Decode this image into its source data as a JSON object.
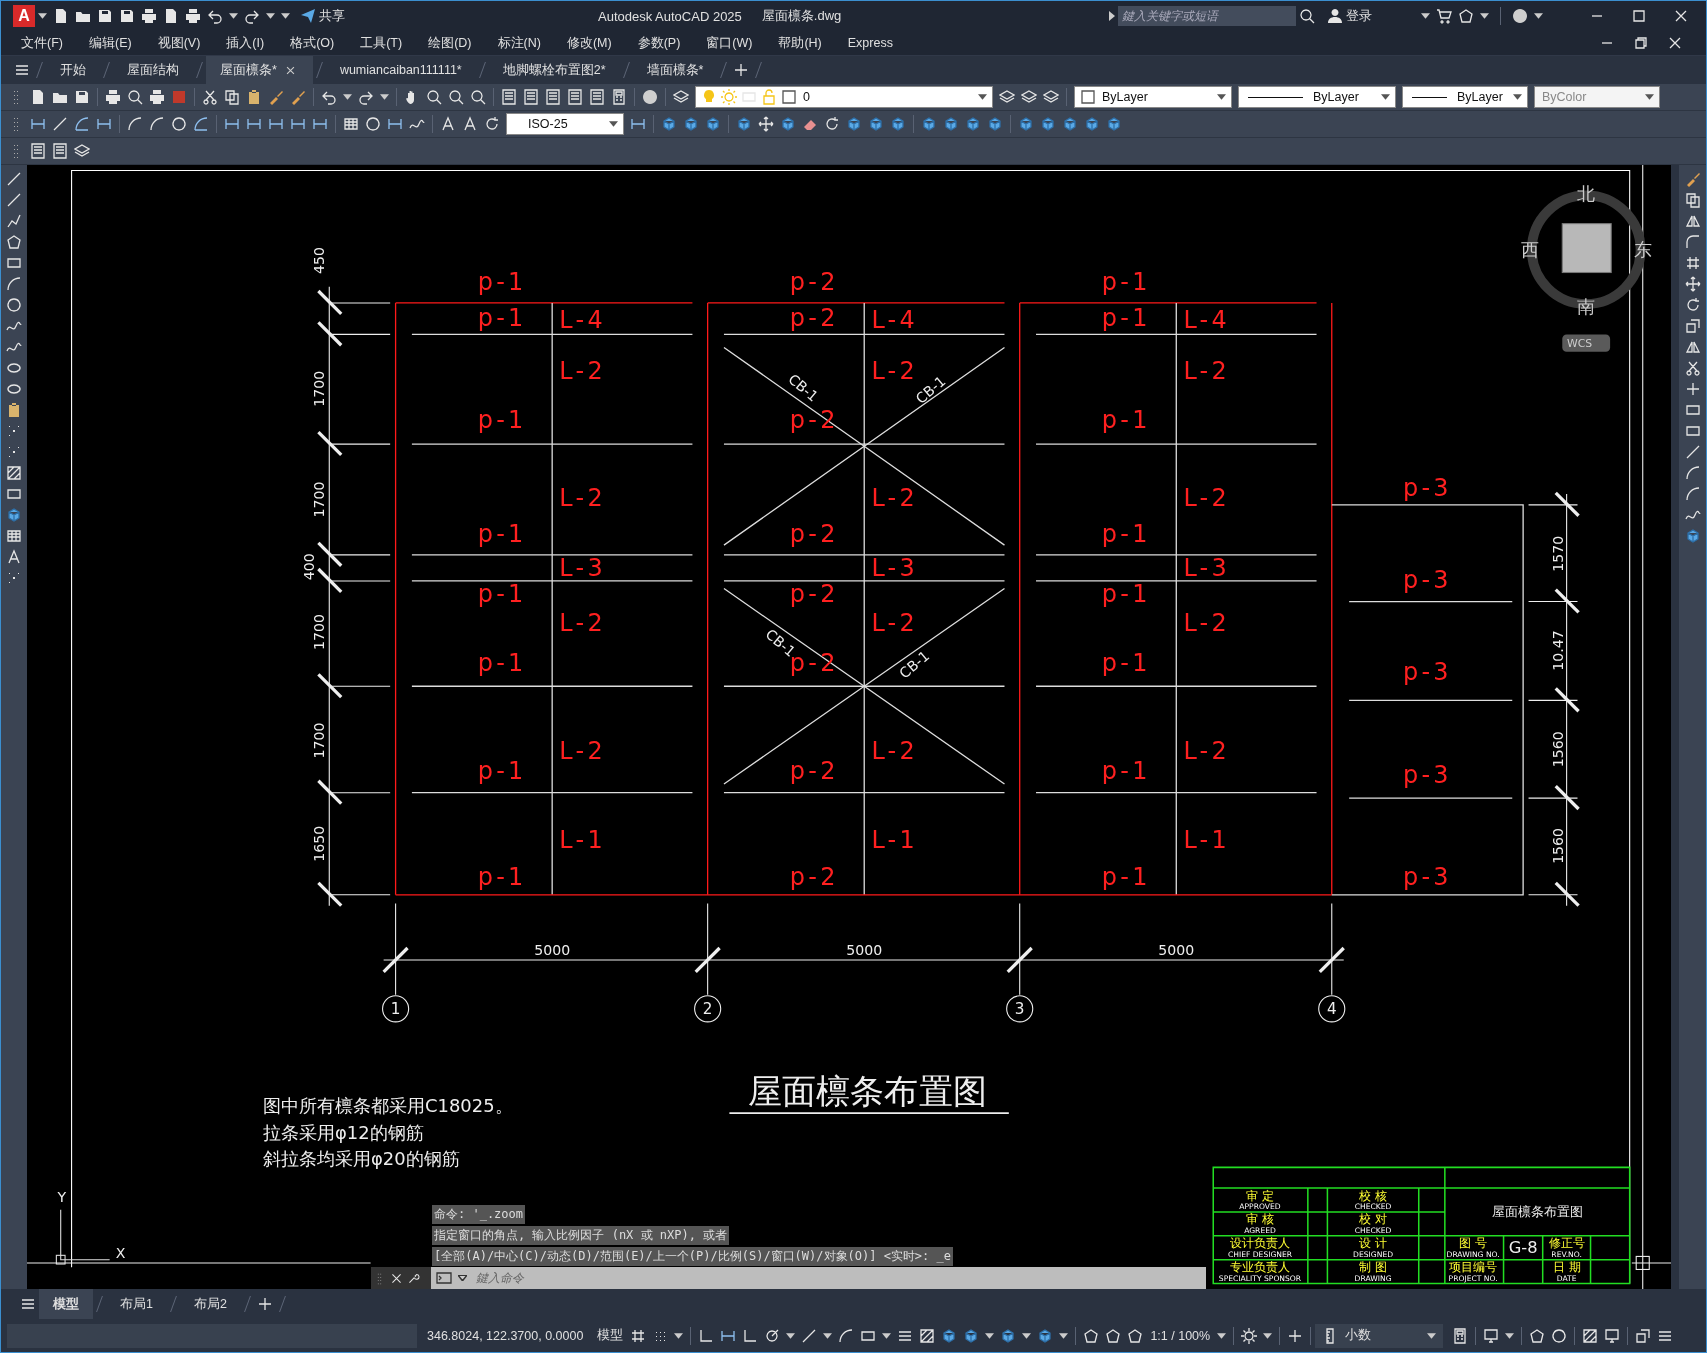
{
  "title_bar": {
    "logo": "A",
    "share": "共享",
    "app_title": "Autodesk AutoCAD 2025",
    "file_name": "屋面檩条.dwg",
    "search": {
      "placeholder": "鍵入关键字或短语"
    },
    "sign_in": "登录"
  },
  "menu": [
    "文件(F)",
    "编辑(E)",
    "视图(V)",
    "插入(I)",
    "格式(O)",
    "工具(T)",
    "绘图(D)",
    "标注(N)",
    "修改(M)",
    "参数(P)",
    "窗口(W)",
    "帮助(H)",
    "Express"
  ],
  "doc_tabs": [
    {
      "label": "开始",
      "selected": false
    },
    {
      "label": "屋面结构",
      "selected": false
    },
    {
      "label": "屋面檩条*",
      "selected": true
    },
    {
      "label": "wumiancaiban111111*",
      "selected": false
    },
    {
      "label": "地脚螺栓布置图2*",
      "selected": false
    },
    {
      "label": "墙面檩条*",
      "selected": false
    }
  ],
  "toolbars": {
    "layer": "0",
    "property_boxes": [
      "ByLayer",
      "ByLayer",
      "ByLayer",
      "ByColor"
    ],
    "dim_style": "ISO-25"
  },
  "drawing": {
    "bays": [
      {
        "purlins": [
          "p-1",
          "p-1",
          "p-1",
          "p-1",
          "p-1",
          "p-1",
          "p-1",
          "p-1"
        ],
        "beams": [
          "L-4",
          "L-2",
          "L-2",
          "L-3",
          "L-2",
          "L-2",
          "L-1"
        ],
        "bracing": false
      },
      {
        "purlins": [
          "p-2",
          "p-2",
          "p-2",
          "p-2",
          "p-2",
          "p-2",
          "p-2",
          "p-2"
        ],
        "beams": [
          "L-4",
          "L-2",
          "L-2",
          "L-3",
          "L-2",
          "L-2",
          "L-1"
        ],
        "bracing": true,
        "brace_labels": [
          "CB-1",
          "CB-1",
          "CB-1",
          "CB-1"
        ]
      },
      {
        "purlins": [
          "p-1",
          "p-1",
          "p-1",
          "p-1",
          "p-1",
          "p-1",
          "p-1",
          "p-1"
        ],
        "beams": [
          "L-4",
          "L-2",
          "L-2",
          "L-3",
          "L-2",
          "L-2",
          "L-1"
        ],
        "bracing": false
      }
    ],
    "side_bay": {
      "purlins": [
        "p-3",
        "p-3",
        "p-3",
        "p-3",
        "p-3"
      ]
    },
    "left_dims": [
      "450",
      "1700",
      "1700",
      "400",
      "1700",
      "1700",
      "1650"
    ],
    "right_dims": [
      "1570",
      "10.47",
      "1560",
      "1560"
    ],
    "spans": [
      "5000",
      "5000",
      "5000"
    ],
    "axes": [
      "1",
      "2",
      "3",
      "4"
    ],
    "title": "屋面檩条布置图",
    "notes": [
      "图中所有檩条都采用C18025。",
      "拉条采用φ12的钢筋",
      "斜拉条均采用φ20的钢筋"
    ],
    "ucs": {
      "x": "X",
      "y": "Y"
    },
    "viewcube": {
      "north": "北",
      "south": "南",
      "west": "西",
      "east": "东",
      "ucs": "WCS"
    },
    "title_block": {
      "left_roles": [
        {
          "cn": "审 定",
          "en": "APPROVED"
        },
        {
          "cn": "审 核",
          "en": "AGREED"
        },
        {
          "cn": "设计负责人",
          "en": "CHIEF DESIGNER"
        },
        {
          "cn": "专业负责人",
          "en": "SPECIALITY SPONSOR"
        }
      ],
      "mid_roles": [
        {
          "cn": "校 核",
          "en": "CHECKED"
        },
        {
          "cn": "校 对",
          "en": "CHECKED"
        },
        {
          "cn": "设 计",
          "en": "DESIGNED"
        },
        {
          "cn": "制 图",
          "en": "DRAWING"
        }
      ],
      "drawing_title": "屋面檩条布置图",
      "fields": [
        {
          "cn": "图 号",
          "en": "DRAWING NO.",
          "value": "G-8"
        },
        {
          "cn": "修正号",
          "en": "REV.NO."
        },
        {
          "cn": "项目编号",
          "en": "PROJECT NO."
        },
        {
          "cn": "日 期",
          "en": "DATE"
        }
      ]
    }
  },
  "command_line": {
    "history": [
      "命令: '_.zoom",
      "指定窗口的角点, 输入比例因子 (nX 或 nXP), 或者",
      "[全部(A)/中心(C)/动态(D)/范围(E)/上一个(P)/比例(S)/窗口(W)/对象(O)] <实时>: _e"
    ],
    "placeholder": "鍵入命令"
  },
  "layout_tabs": [
    {
      "label": "模型",
      "selected": true
    },
    {
      "label": "布局1",
      "selected": false
    },
    {
      "label": "布局2",
      "selected": false
    }
  ],
  "status_bar": {
    "coordinates": "346.8024, 122.3700, 0.0000",
    "space": "模型",
    "scale": "1:1 / 100%",
    "units": "小数"
  }
}
